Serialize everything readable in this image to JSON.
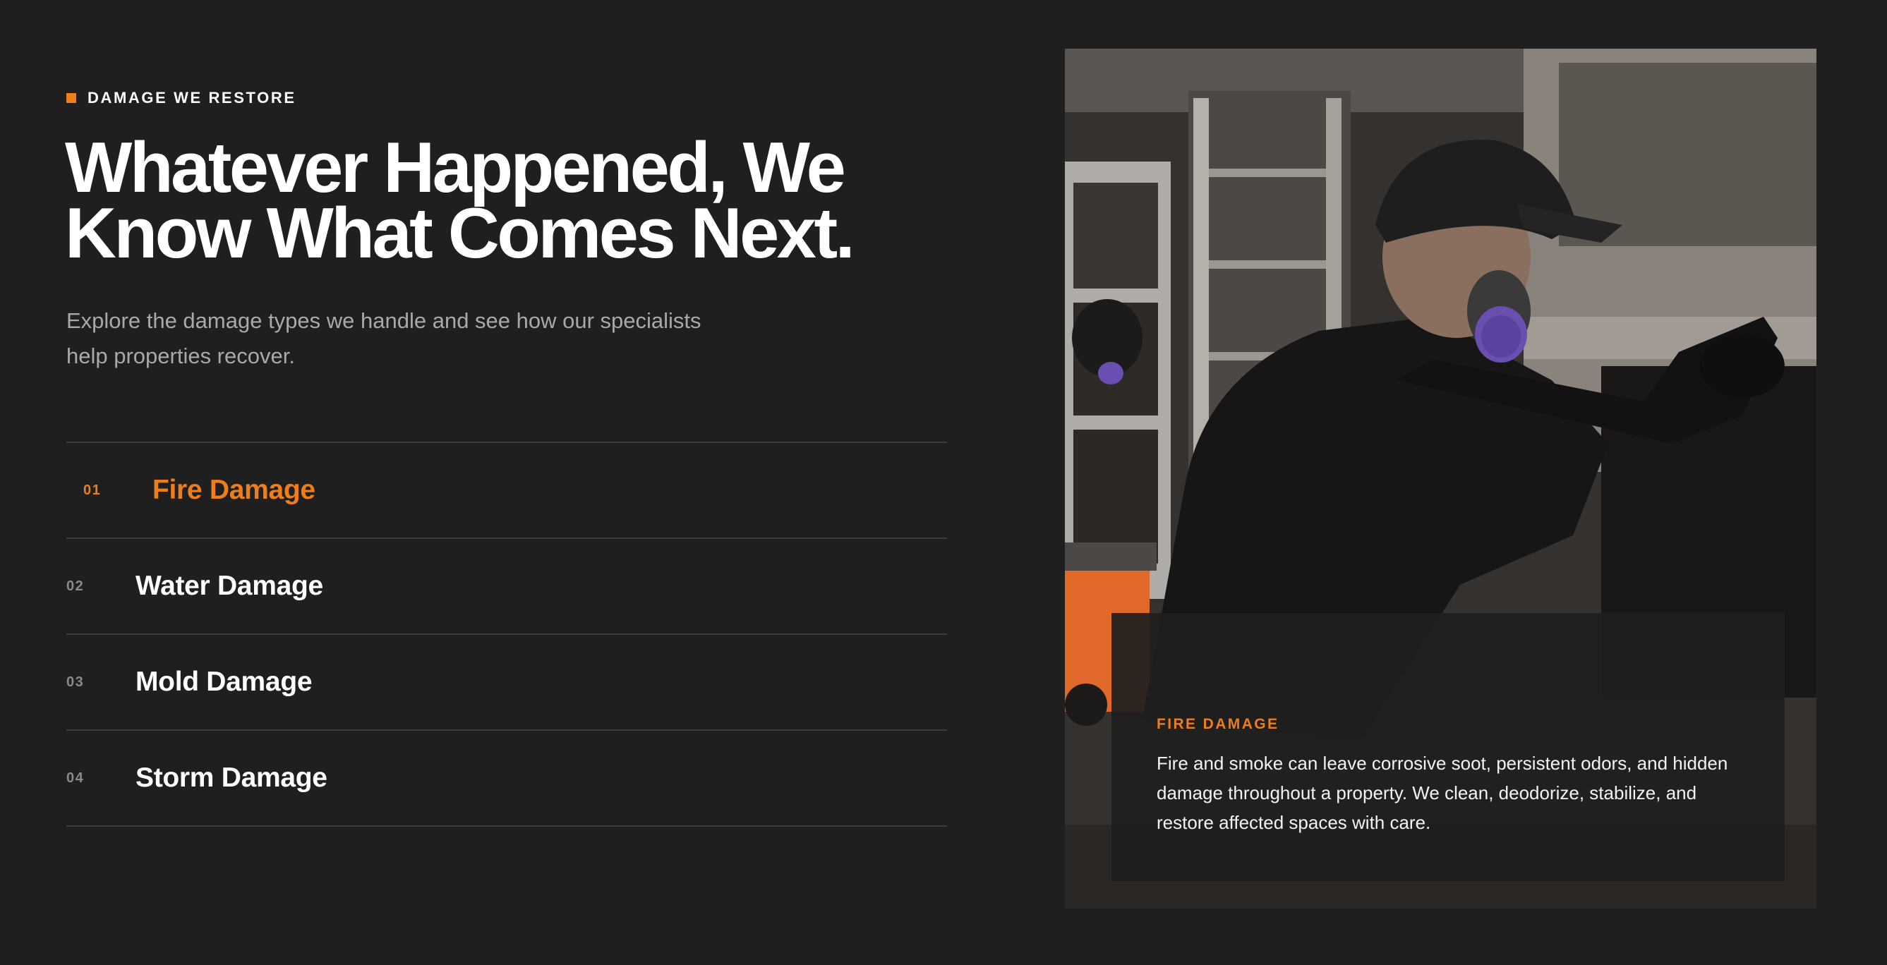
{
  "section": {
    "eyebrow": "DAMAGE WE RESTORE",
    "headline_line1": "Whatever Happened, We",
    "headline_line2": "Know What Comes Next.",
    "subtitle_line1": "Explore the damage types we handle and see how our specialists",
    "subtitle_line2": "help properties recover."
  },
  "damage_list": [
    {
      "number": "01",
      "label": "Fire Damage",
      "active": true
    },
    {
      "number": "02",
      "label": "Water Damage",
      "active": false
    },
    {
      "number": "03",
      "label": "Mold Damage",
      "active": false
    },
    {
      "number": "04",
      "label": "Storm Damage",
      "active": false
    }
  ],
  "detail_card": {
    "title": "FIRE DAMAGE",
    "description": "Fire and smoke can leave corrosive soot, persistent odors, and hidden damage throughout a property. We clean, deodorize, stabilize, and restore affected spaces with care."
  },
  "colors": {
    "background": "#1f1f1f",
    "accent": "#ef7d1a",
    "text": "#ffffff",
    "muted_text": "#a9a9a9",
    "divider": "#3d3d3d"
  },
  "icons": {
    "eyebrow_marker": "orange-square-icon"
  }
}
